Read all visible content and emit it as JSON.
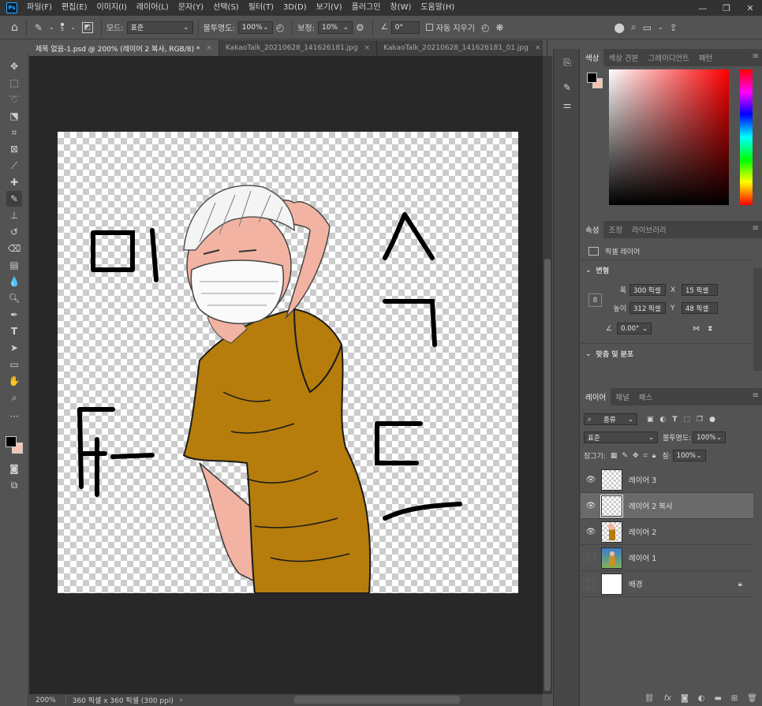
{
  "menubar": {
    "logo": "Ps",
    "items": [
      "파일(F)",
      "편집(E)",
      "이미지(I)",
      "레이어(L)",
      "문자(Y)",
      "선택(S)",
      "필터(T)",
      "3D(D)",
      "보기(V)",
      "플러그인",
      "창(W)",
      "도움말(H)"
    ],
    "controls": [
      "—",
      "❐",
      "✕"
    ]
  },
  "options": {
    "brush_size": "5",
    "mode_label": "모드:",
    "mode_value": "표준",
    "opacity_label": "불투명도:",
    "opacity_value": "100%",
    "smoothing_label": "보정:",
    "smoothing_value": "10%",
    "angle_value": "0°",
    "auto_erase_label": "자동 지우기"
  },
  "tabs": [
    {
      "label": "제목 없음-1.psd @ 200% (레이어 2 복사, RGB/8) *",
      "close": "×"
    },
    {
      "label": "KakaoTalk_20210628_141626181.jpg",
      "close": "×"
    },
    {
      "label": "KakaoTalk_20210628_141626181_01.jpg",
      "close": "×"
    }
  ],
  "status": {
    "zoom": "200%",
    "doc_size": "360 픽셀 x 360 픽셀 (300 ppi)",
    "arrow": "›"
  },
  "color_panel": {
    "tabs": [
      "색상",
      "색상 견본",
      "그레이디언트",
      "패턴"
    ]
  },
  "properties_panel": {
    "tabs": [
      "속성",
      "조정",
      "라이브러리"
    ],
    "layer_type": "픽셀 레이어",
    "transform_heading": "변형",
    "w_label": "폭",
    "w_value": "300 픽셀",
    "h_label": "높이",
    "h_value": "312 픽셀",
    "x_label": "X",
    "x_value": "15 픽셀",
    "y_label": "Y",
    "y_value": "48 픽셀",
    "angle_value": "0.00°",
    "align_heading": "맞춤 및 분포"
  },
  "layers_panel": {
    "tabs": [
      "레이어",
      "채널",
      "패스"
    ],
    "filter_label": "종류",
    "blend_mode": "표준",
    "opacity_label": "불투명도:",
    "opacity_value": "100%",
    "lock_label": "잠그기:",
    "fill_label": "칠:",
    "fill_value": "100%",
    "layers": [
      {
        "name": "레이어 3",
        "visible": true,
        "active": false
      },
      {
        "name": "레이어 2 복사",
        "visible": true,
        "active": true
      },
      {
        "name": "레이어 2",
        "visible": true,
        "active": false
      },
      {
        "name": "레이어 1",
        "visible": false,
        "active": false
      },
      {
        "name": "배경",
        "visible": false,
        "active": false,
        "locked": true
      }
    ]
  },
  "colors": {
    "foreground": "#000000",
    "background": "#f7c3b0",
    "shirt": "#b67d0c",
    "skin": "#f2b3a2"
  }
}
